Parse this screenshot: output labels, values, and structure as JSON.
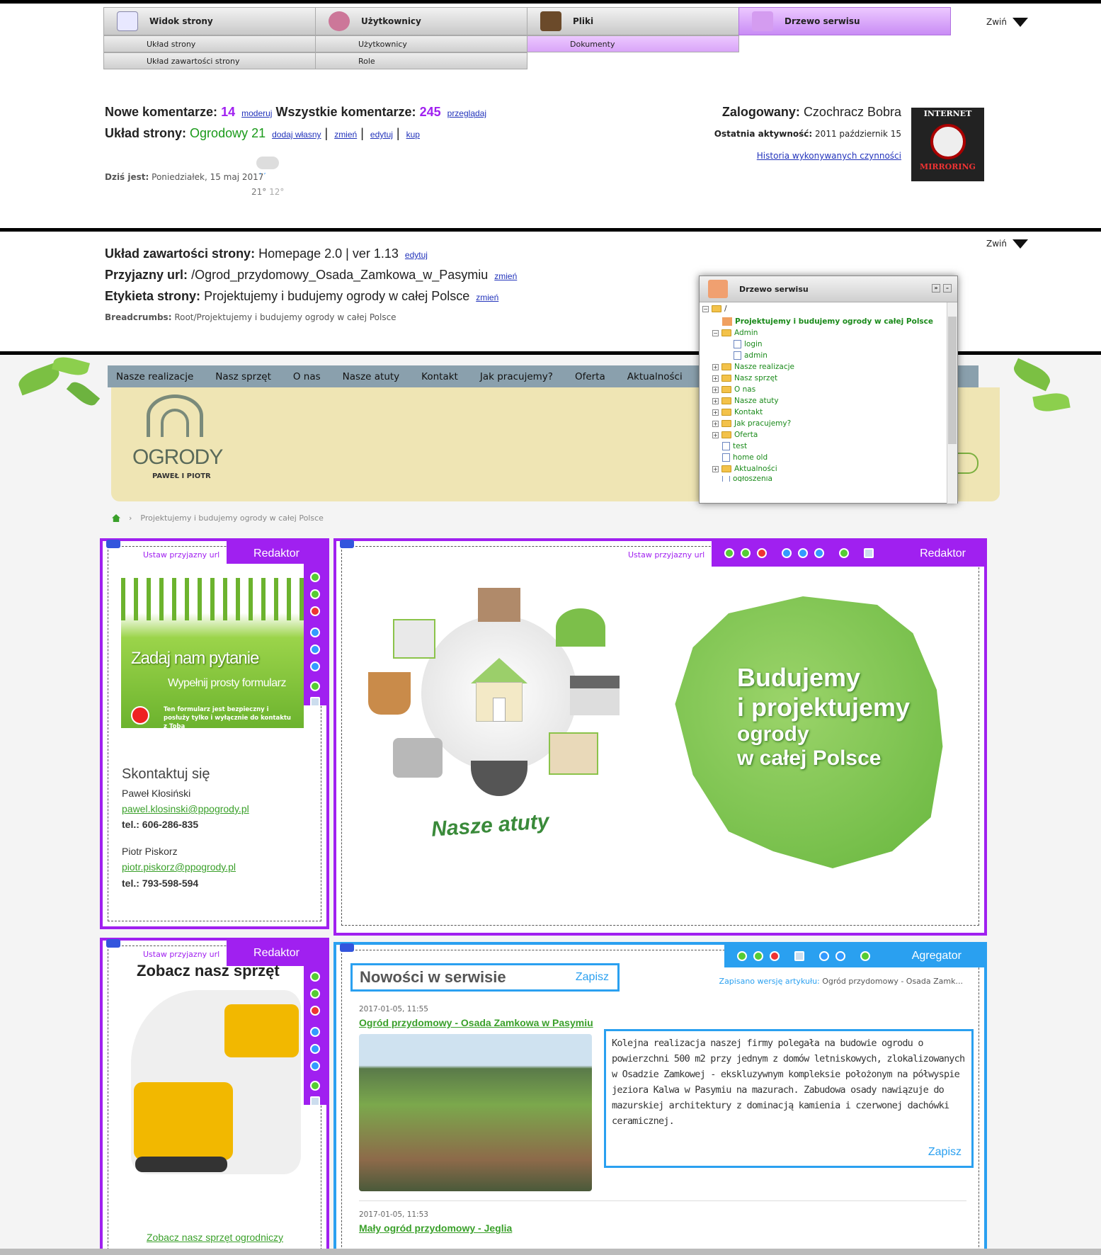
{
  "admin_tabs": [
    {
      "label": "Widok strony",
      "icon": "page-view-icon"
    },
    {
      "label": "Użytkownicy",
      "icon": "users-icon"
    },
    {
      "label": "Pliki",
      "icon": "files-icon"
    },
    {
      "label": "Drzewo serwisu",
      "icon": "site-tree-icon"
    }
  ],
  "admin_subtabs": {
    "widok": [
      "Układ strony",
      "Układ zawartości strony"
    ],
    "users": [
      "Użytkownicy",
      "Role"
    ],
    "files": [
      "Dokumenty"
    ]
  },
  "collapse_label": "Zwiń",
  "stats": {
    "new_comments_label": "Nowe komentarze:",
    "new_comments_count": "14",
    "moderate": "moderuj",
    "all_comments_label": "Wszystkie komentarze:",
    "all_comments_count": "245",
    "browse": "przeglądaj",
    "layout_label": "Układ strony:",
    "layout_value": "Ogrodowy 21",
    "add_own": "dodaj własny",
    "change": "zmień",
    "edit": "edytuj",
    "buy": "kup",
    "today_label": "Dziś jest:",
    "today_value": "Poniedziałek, 15 maj 2017",
    "temp_high": "21°",
    "temp_low": "12°"
  },
  "user": {
    "logged_label": "Zalogowany:",
    "logged_name": "Czochracz Bobra",
    "last_activity_label": "Ostatnia aktywność:",
    "last_activity_value": "2011 październik 15",
    "history_link": "Historia wykonywanych czynności",
    "avatar_text_top": "INTERNET",
    "avatar_text_bottom": "MIRRORING"
  },
  "content_layout": {
    "label": "Układ zawartości strony:",
    "value": "Homepage 2.0 | ver 1.13",
    "edit": "edytuj",
    "friendly_url_label": "Przyjazny url:",
    "friendly_url_value": "/Ogrod_przydomowy_Osada_Zamkowa_w_Pasymiu",
    "change": "zmień",
    "page_label_label": "Etykieta strony:",
    "page_label_value": "Projektujemy i budujemy ogrody w całej Polsce",
    "breadcrumbs_label": "Breadcrumbs:",
    "breadcrumbs_value": "Root/Projektujemy i budujemy ogrody w całej Polsce"
  },
  "tree_panel": {
    "title": "Drzewo serwisu",
    "root": "/",
    "items": [
      "Projektujemy i budujemy ogrody w całej Polsce",
      "Admin",
      "login",
      "admin",
      "Nasze realizacje",
      "Nasz sprzęt",
      "O nas",
      "Nasze atuty",
      "Kontakt",
      "Jak pracujemy?",
      "Oferta",
      "test",
      "home old",
      "Aktualności",
      "ogłoszenia"
    ]
  },
  "site_nav": [
    "Nasze realizacje",
    "Nasz sprzęt",
    "O nas",
    "Nasze atuty",
    "Kontakt",
    "Jak pracujemy?",
    "Oferta",
    "Aktualności"
  ],
  "logo": {
    "name": "OGRODY",
    "sub": "PAWEŁ I PIOTR"
  },
  "site_breadcrumb": "Projektujemy i budujemy ogrody w całej Polsce",
  "editor_label": "Redaktor",
  "aggregator_label": "Agregator",
  "set_friendly_url": "Ustaw przyjazny url",
  "question_banner": {
    "title": "Zadaj nam pytanie",
    "sub": "Wypełnij prosty formularz",
    "note": "Ten formularz jest bezpieczny i posłuży tylko i wyłącznie do kontaktu z Tobą"
  },
  "contact": {
    "title": "Skontaktuj się",
    "p1_name": "Paweł Kłosiński",
    "p1_email": "pawel.klosinski@ppogrody.pl",
    "p1_tel": "tel.: 606-286-835",
    "p2_name": "Piotr Piskorz",
    "p2_email": "piotr.piskorz@ppogrody.pl",
    "p2_tel": "tel.: 793-598-594"
  },
  "hero": {
    "atuty": "Nasze atuty",
    "line1": "Budujemy",
    "line2": "i projektujemy",
    "line3": "ogrody",
    "line4": "w całej Polsce"
  },
  "equipment": {
    "title": "Zobacz nasz sprzęt",
    "link": "Zobacz nasz sprzęt ogrodniczy"
  },
  "news": {
    "title": "Nowości w serwisie",
    "save": "Zapisz",
    "saved_label": "Zapisano wersję artykułu:",
    "saved_value": "Ogród przydomowy - Osada Zamk...",
    "item1_date": "2017-01-05, 11:55",
    "item1_title": "Ogród przydomowy - Osada Zamkowa w Pasymiu",
    "item1_text": "Kolejna realizacja naszej firmy polegała na budowie ogrodu o powierzchni 500 m2 przy jednym z domów letniskowych, zlokalizowanych w Osadzie Zamkowej - ekskluzywnym kompleksie położonym na półwyspie jeziora Kalwa w Pasymiu na mazurach. Zabudowa osady nawiązuje do mazurskiej architektury z dominacją kamienia i czerwonej dachówki ceramicznej.",
    "item2_date": "2017-01-05, 11:53",
    "item2_title": "Mały ogród przydomowy - Jeglia"
  },
  "colors": {
    "accent_purple": "#a020f0",
    "accent_blue": "#2aa0f0",
    "green": "#3aa02a"
  }
}
